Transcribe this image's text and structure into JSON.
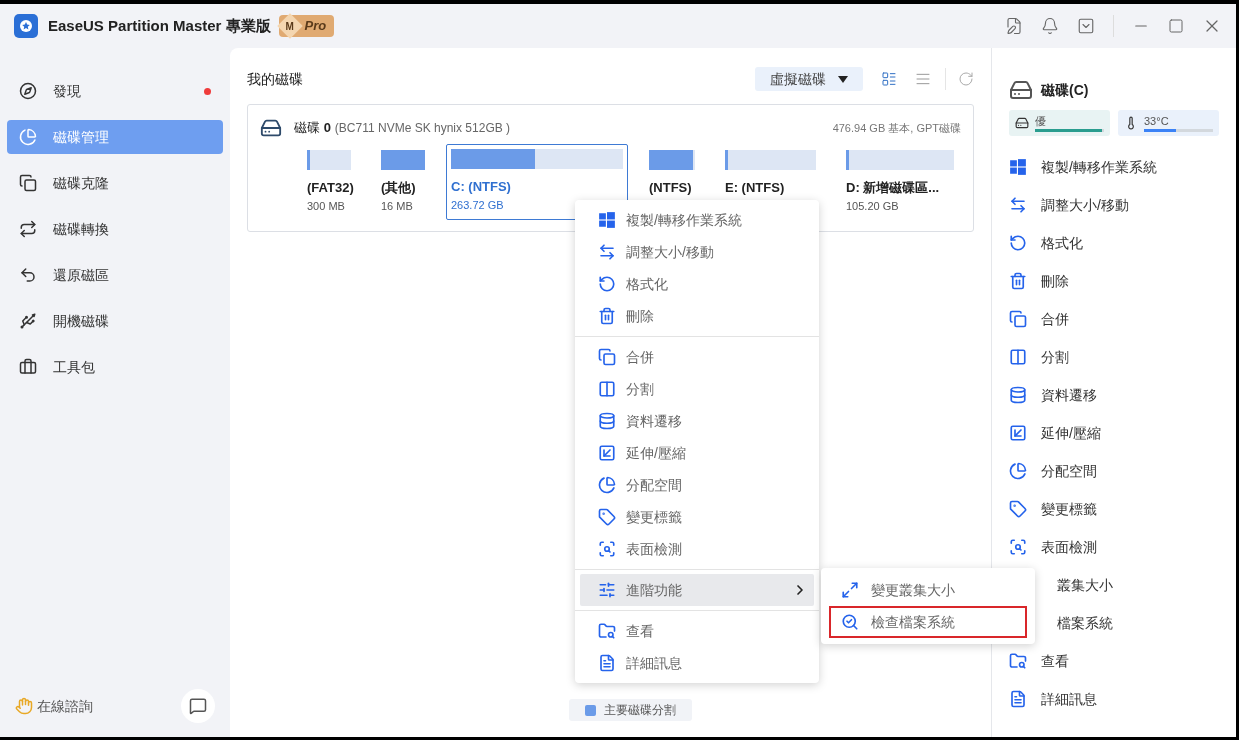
{
  "window": {
    "title": "EaseUS Partition Master 專業版",
    "badge_letter": "M",
    "badge": "Pro"
  },
  "sidebar": {
    "items": [
      {
        "label": "發現",
        "selected": false,
        "dot": true
      },
      {
        "label": "磁碟管理",
        "selected": true,
        "dot": false
      },
      {
        "label": "磁碟克隆",
        "selected": false,
        "dot": false
      },
      {
        "label": "磁碟轉換",
        "selected": false,
        "dot": false
      },
      {
        "label": "還原磁區",
        "selected": false,
        "dot": false
      },
      {
        "label": "開機磁碟",
        "selected": false,
        "dot": false
      },
      {
        "label": "工具包",
        "selected": false,
        "dot": false
      }
    ],
    "consult": "在線諮詢"
  },
  "main": {
    "title": "我的磁碟",
    "virtual_disk": "虛擬磁碟",
    "disk": {
      "name": "磁碟",
      "number": "0",
      "model": "(BC711 NVMe SK hynix 512GB )",
      "info": "476.94 GB 基本, GPT磁碟",
      "partitions": [
        {
          "label": "(FAT32)",
          "size": "300 MB",
          "level": 0.05,
          "selected": false
        },
        {
          "label": "(其他)",
          "size": "16 MB",
          "level": 1,
          "selected": false
        },
        {
          "label": "C: (NTFS)",
          "size": "263.72 GB",
          "level": 0.49,
          "selected": true
        },
        {
          "label": "(NTFS)",
          "level": 0.95,
          "selected": false
        },
        {
          "label": "E: (NTFS)",
          "level": 0.03,
          "selected": false
        },
        {
          "label": "D: 新增磁碟區...",
          "size": "105.20 GB",
          "level": 0.02,
          "selected": false
        }
      ]
    },
    "legend": "主要磁碟分割"
  },
  "context_menu": {
    "groups": [
      [
        {
          "label": "複製/轉移作業系統"
        },
        {
          "label": "調整大小/移動"
        },
        {
          "label": "格式化"
        },
        {
          "label": "刪除"
        }
      ],
      [
        {
          "label": "合併"
        },
        {
          "label": "分割"
        },
        {
          "label": "資料遷移"
        },
        {
          "label": "延伸/壓縮"
        },
        {
          "label": "分配空間"
        },
        {
          "label": "變更標籤"
        },
        {
          "label": "表面檢測"
        }
      ],
      [
        {
          "label": "進階功能",
          "selected": true
        }
      ],
      [
        {
          "label": "查看"
        },
        {
          "label": "詳細訊息"
        }
      ]
    ]
  },
  "submenu": {
    "items": [
      {
        "label": "變更叢集大小",
        "highlighted": false
      },
      {
        "label": "檢查檔案系統",
        "highlighted": true
      }
    ]
  },
  "right_panel": {
    "title": "磁碟(C)",
    "health": {
      "label": "優",
      "level": 0.97
    },
    "temperature": {
      "label": "33°C",
      "level": 0.47
    },
    "actions": [
      {
        "label": "複製/轉移作業系統",
        "kind": "action"
      },
      {
        "label": "調整大小/移動",
        "kind": "action"
      },
      {
        "label": "格式化",
        "kind": "action"
      },
      {
        "label": "刪除",
        "kind": "action"
      },
      {
        "label": "合併",
        "kind": "action"
      },
      {
        "label": "分割",
        "kind": "action"
      },
      {
        "label": "資料遷移",
        "kind": "action"
      },
      {
        "label": "延伸/壓縮",
        "kind": "action"
      },
      {
        "label": "分配空間",
        "kind": "action"
      },
      {
        "label": "變更標籤",
        "kind": "action"
      },
      {
        "label": "表面檢測",
        "kind": "action"
      },
      {
        "label": "叢集大小",
        "kind": "covered"
      },
      {
        "label": "檔案系統",
        "kind": "covered"
      },
      {
        "label": "查看",
        "kind": "action"
      },
      {
        "label": "詳細訊息",
        "kind": "action"
      }
    ]
  }
}
